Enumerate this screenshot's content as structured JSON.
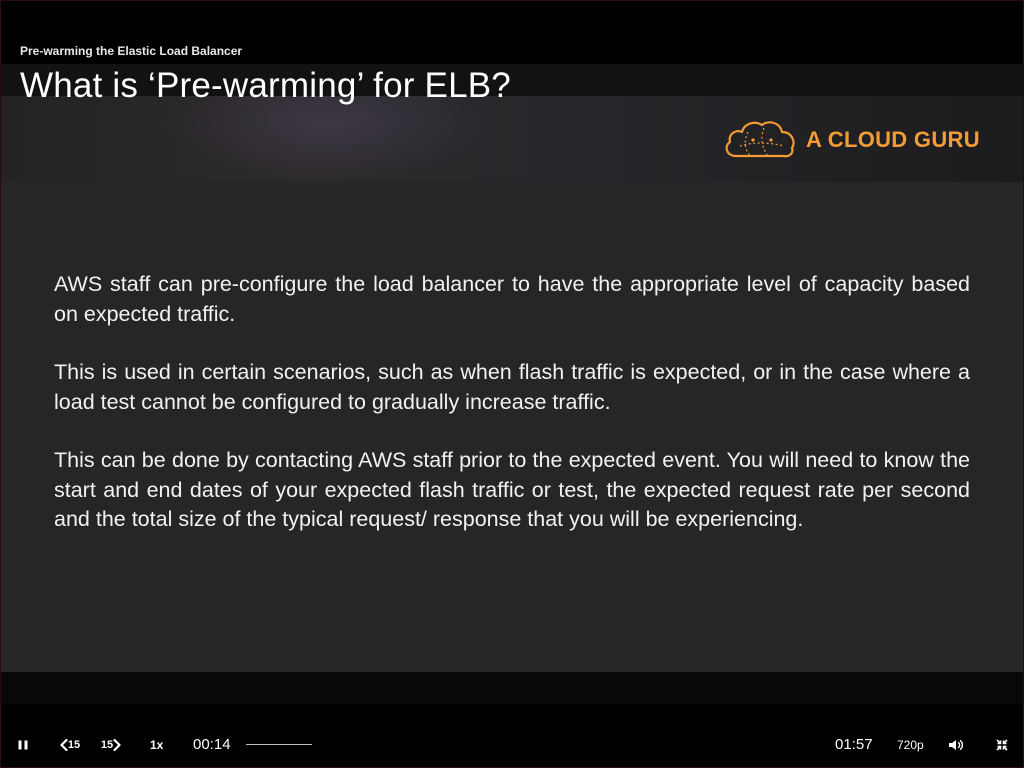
{
  "slide": {
    "subtitle": "Pre-warming the Elastic Load Balancer",
    "title": "What is ‘Pre-warming’ for ELB?",
    "logo_text": "A CLOUD GURU",
    "paragraphs": [
      "AWS staff can pre-configure the load balancer to have the appropriate level of capacity based on expected traffic.",
      "This is used in certain scenarios, such as when flash traffic is expected, or in the case where a load test cannot be configured to gradually increase traffic.",
      "This can be done by contacting AWS staff prior to the expected event. You will need to know the start and end dates of your expected flash traffic or test, the expected request rate per second and the total size of the typical request/ response that you will be experiencing."
    ]
  },
  "controls": {
    "play_state": "pause",
    "rewind_label": "15",
    "forward_label": "15",
    "playback_rate": "1x",
    "current_time": "00:14",
    "duration": "01:57",
    "quality": "720p",
    "volume_icon": "volume-icon",
    "fullscreen_icon": "exit-fullscreen-icon"
  },
  "colors": {
    "brand_orange": "#f39c35",
    "slide_background": "#262527",
    "player_background": "#000000"
  }
}
